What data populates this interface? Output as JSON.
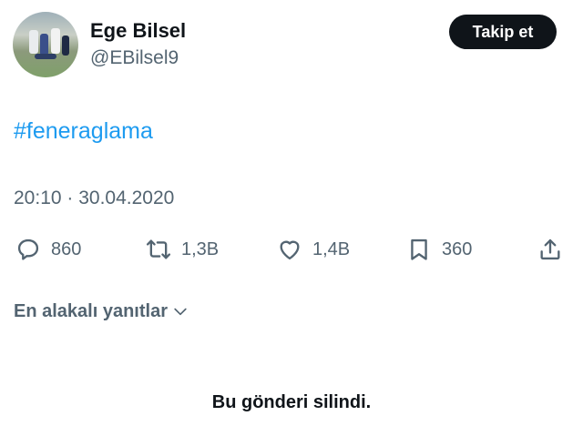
{
  "author": {
    "name": "Ege Bilsel",
    "handle": "@EBilsel9"
  },
  "follow_button": {
    "label": "Takip et"
  },
  "tweet": {
    "hashtag": "#feneraglama",
    "timestamp": "20:10 · 30.04.2020"
  },
  "actions": {
    "replies": {
      "icon": "reply-icon",
      "count": "860"
    },
    "retweets": {
      "icon": "retweet-icon",
      "count": "1,3B"
    },
    "likes": {
      "icon": "like-icon",
      "count": "1,4B"
    },
    "bookmarks": {
      "icon": "bookmark-icon",
      "count": "360"
    },
    "share": {
      "icon": "share-icon"
    }
  },
  "replies_sort": {
    "label": "En alakalı yanıtlar",
    "icon": "chevron-down-icon"
  },
  "deleted_notice": "Bu gönderi silindi.",
  "colors": {
    "link": "#1d9bf0",
    "text_primary": "#0f1419",
    "text_secondary": "#536471",
    "button_bg": "#0f1419"
  }
}
